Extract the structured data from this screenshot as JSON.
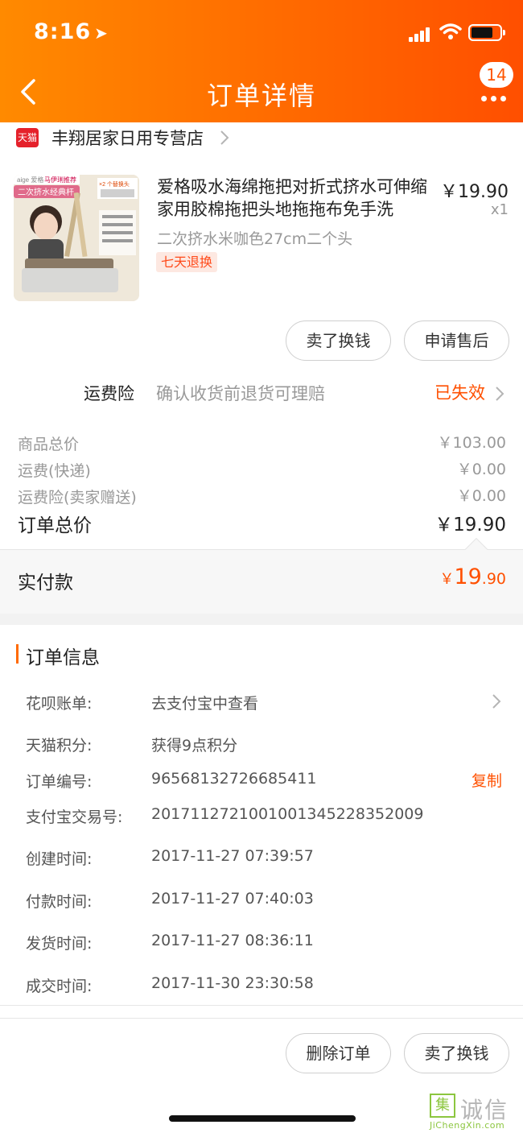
{
  "status_bar": {
    "time": "8:16"
  },
  "header": {
    "title": "订单详情",
    "badge_count": "14"
  },
  "store": {
    "logo_text": "天猫",
    "name": "丰翔居家日用专营店"
  },
  "product": {
    "title": "爱格吸水海绵拖把对折式挤水可伸缩家用胶棉拖把头地拖拖布免手洗",
    "price": "￥19.90",
    "quantity": "x1",
    "spec": "二次挤水米咖色27cm二个头",
    "tag": "七天退换",
    "image_texts": {
      "brand": "aige 爱格",
      "promo": "马伊琍推荐",
      "banner": "二次挤水经典杆",
      "badge": "×2 个替换头"
    }
  },
  "actions": {
    "sell": "卖了换钱",
    "after_sale": "申请售后"
  },
  "freight_insurance": {
    "label": "运费险",
    "desc": "确认收货前退货可理赔",
    "status": "已失效"
  },
  "summary": {
    "items": [
      {
        "label": "商品总价",
        "value": "￥103.00"
      },
      {
        "label": "运费(快递)",
        "value": "￥0.00"
      },
      {
        "label": "运费险(卖家赠送)",
        "value": "￥0.00"
      }
    ],
    "total_label": "订单总价",
    "total_value": "￥19.90",
    "paid_label": "实付款",
    "paid_currency": "￥",
    "paid_int": "19",
    "paid_dec": ".90"
  },
  "order_info": {
    "title": "订单信息",
    "rows": [
      {
        "label": "花呗账单:",
        "value": "去支付宝中查看"
      },
      {
        "label": "天猫积分:",
        "value": "获得9点积分"
      },
      {
        "label": "订单编号:",
        "value": "96568132726685411"
      },
      {
        "label": "支付宝交易号:",
        "value": "2017112721001001345228352009"
      },
      {
        "label": "创建时间:",
        "value": "2017-11-27 07:39:57"
      },
      {
        "label": "付款时间:",
        "value": "2017-11-27 07:40:03"
      },
      {
        "label": "发货时间:",
        "value": "2017-11-27 08:36:11"
      },
      {
        "label": "成交时间:",
        "value": "2017-11-30 23:30:58"
      }
    ],
    "copy_label": "复制"
  },
  "bottom_actions": {
    "delete": "删除订单",
    "sell": "卖了换钱"
  },
  "watermark": {
    "icon_text": "集",
    "text": "诚信",
    "url": "JiChengXin.com"
  }
}
